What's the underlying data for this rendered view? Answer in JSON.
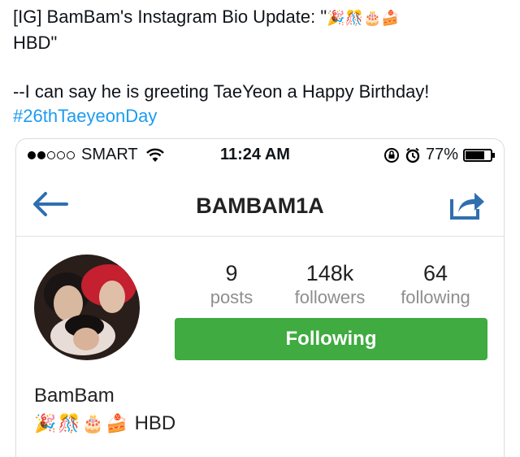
{
  "tweet": {
    "line1_prefix": "[IG] BamBam's Instagram Bio Update: \"",
    "line1_emojis": "🎉🎊🎂🍰",
    "line2": "HBD\"",
    "line3": "--I can say he is greeting TaeYeon a Happy Birthday!",
    "hashtag": "#26thTaeyeonDay"
  },
  "statusbar": {
    "carrier": "SMART",
    "time": "11:24 AM",
    "battery": "77%",
    "signal_full": 2,
    "signal_empty": 3
  },
  "navbar": {
    "title": "BAMBAM1A"
  },
  "profile": {
    "posts_count": "9",
    "posts_label": "posts",
    "followers_count": "148k",
    "followers_label": "followers",
    "following_count": "64",
    "following_label": "following",
    "follow_button": "Following",
    "name": "BamBam",
    "bio_emojis": "🎉🎊🎂🍰",
    "bio_text": "HBD"
  },
  "colors": {
    "accent": "#1d9bf0",
    "nav_icon": "#2f6fb0",
    "follow_green": "#3fab40"
  }
}
